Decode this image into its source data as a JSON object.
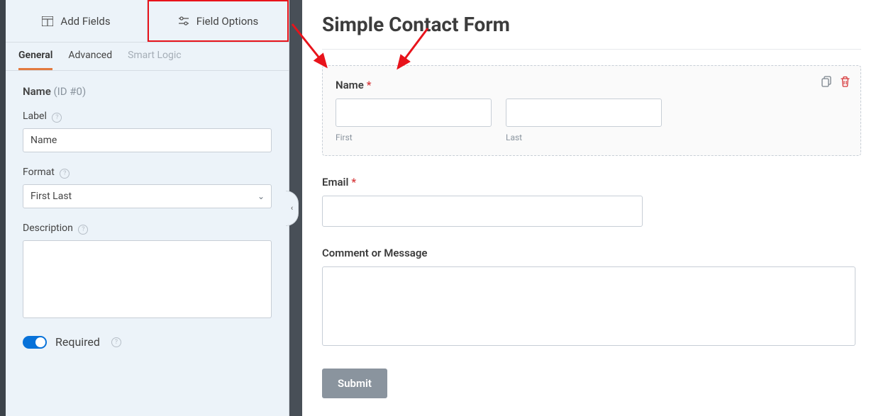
{
  "sidebar": {
    "top_tabs": {
      "add_fields": "Add Fields",
      "field_options": "Field Options"
    },
    "sub_tabs": {
      "general": "General",
      "advanced": "Advanced",
      "smart_logic": "Smart Logic"
    },
    "header": {
      "name": "Name",
      "id": "(ID #0)"
    },
    "label_field": {
      "label": "Label",
      "value": "Name"
    },
    "format_field": {
      "label": "Format",
      "value": "First Last"
    },
    "description_field": {
      "label": "Description",
      "value": ""
    },
    "required_toggle": {
      "label": "Required",
      "on": true
    }
  },
  "main": {
    "title": "Simple Contact Form",
    "fields": {
      "name": {
        "label": "Name",
        "first_sub": "First",
        "last_sub": "Last",
        "required": true
      },
      "email": {
        "label": "Email",
        "required": true
      },
      "message": {
        "label": "Comment or Message",
        "required": false
      }
    },
    "submit": "Submit"
  },
  "annotations": {
    "highlight_box_color": "#e8131b",
    "arrow_color": "#e8131b"
  }
}
